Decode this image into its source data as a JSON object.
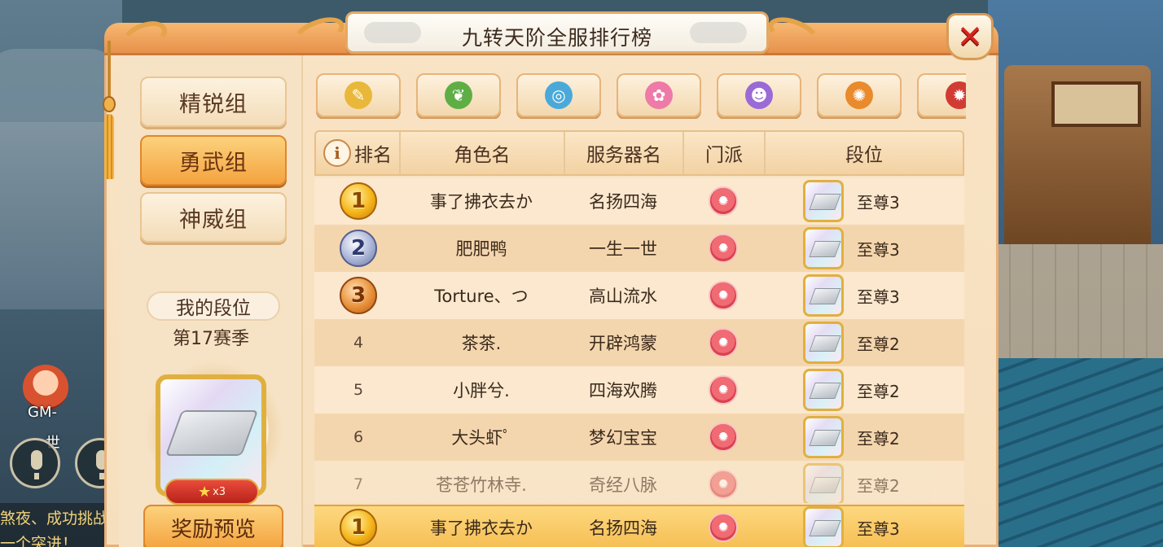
{
  "title": "九转天阶全服排行榜",
  "background": {
    "gm_label": "GM-",
    "gm_sub": "世",
    "chat_line1": "煞夜、成功挑战",
    "chat_line2": "一个突进！"
  },
  "groups": [
    {
      "label": "精锐组",
      "active": false
    },
    {
      "label": "勇武组",
      "active": true
    },
    {
      "label": "神威组",
      "active": false
    }
  ],
  "my_rank": {
    "label": "我的段位",
    "season": "第17赛季",
    "stars": "x3",
    "reward_button": "奖励预览"
  },
  "school_tabs": [
    {
      "icon": "gold-feather-icon",
      "color": "#e9b73a"
    },
    {
      "icon": "green-leaf-icon",
      "color": "#5fae45"
    },
    {
      "icon": "blue-dragon-icon",
      "color": "#4aa9d9"
    },
    {
      "icon": "pink-lotus-icon",
      "color": "#ee7aa8"
    },
    {
      "icon": "purple-skull-icon",
      "color": "#9a6ad6"
    },
    {
      "icon": "orange-lion-icon",
      "color": "#e98a2c"
    },
    {
      "icon": "red-beast-icon",
      "color": "#d23b34"
    }
  ],
  "table": {
    "headers": {
      "rank": "排名",
      "name": "角色名",
      "server": "服务器名",
      "school": "门派",
      "tier": "段位"
    },
    "rows": [
      {
        "rank": "1",
        "name": "事了拂衣去か",
        "server": "名扬四海",
        "tier": "至尊3",
        "medal": "gold"
      },
      {
        "rank": "2",
        "name": "肥肥鸭",
        "server": "一生一世",
        "tier": "至尊3",
        "medal": "silver"
      },
      {
        "rank": "3",
        "name": "Torture、つ",
        "server": "高山流水",
        "tier": "至尊3",
        "medal": "bronze"
      },
      {
        "rank": "4",
        "name": "茶茶.",
        "server": "开辟鸿蒙",
        "tier": "至尊2",
        "medal": ""
      },
      {
        "rank": "5",
        "name": "小胖兮.",
        "server": "四海欢腾",
        "tier": "至尊2",
        "medal": ""
      },
      {
        "rank": "6",
        "name": "大头虾ﾟ",
        "server": "梦幻宝宝",
        "tier": "至尊2",
        "medal": ""
      },
      {
        "rank": "7",
        "name": "苍苍竹林寺.",
        "server": "奇经八脉",
        "tier": "至尊2",
        "medal": ""
      }
    ],
    "my_row": {
      "rank": "1",
      "name": "事了拂衣去か",
      "server": "名扬四海",
      "tier": "至尊3",
      "medal": "gold"
    }
  }
}
